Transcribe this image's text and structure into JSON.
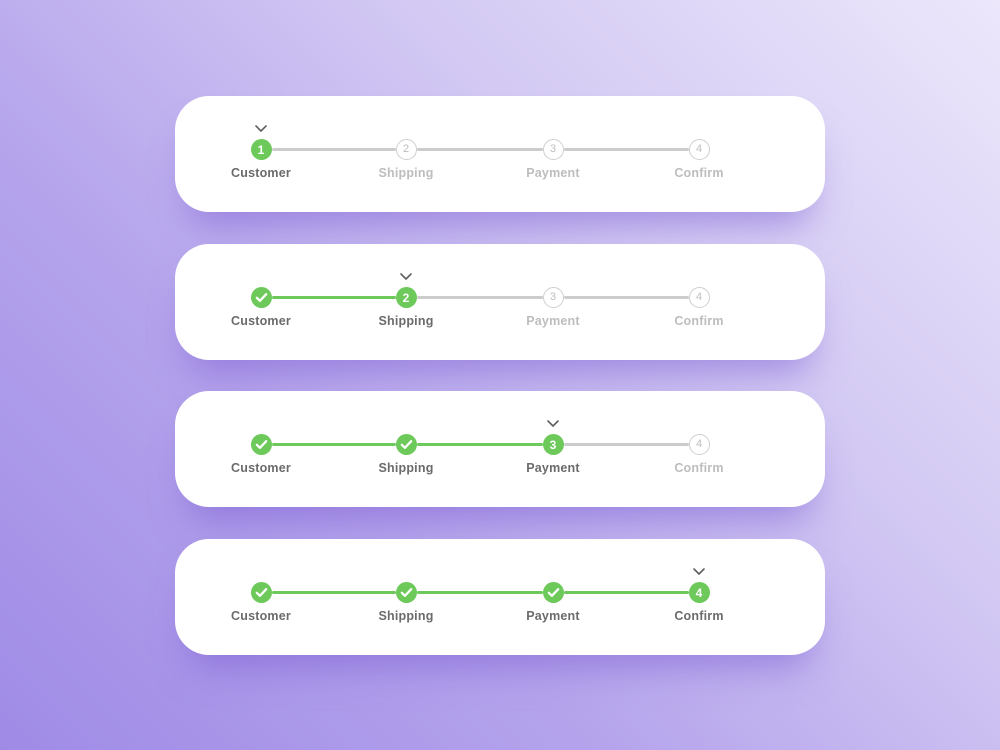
{
  "colors": {
    "accent": "#6cc95a",
    "track_inactive": "#cccccc",
    "caret": "#5f5f5f"
  },
  "steps": [
    {
      "number": "1",
      "label": "Customer"
    },
    {
      "number": "2",
      "label": "Shipping"
    },
    {
      "number": "3",
      "label": "Payment"
    },
    {
      "number": "4",
      "label": "Confirm"
    }
  ],
  "steppers": [
    {
      "current_step": 1
    },
    {
      "current_step": 2
    },
    {
      "current_step": 3
    },
    {
      "current_step": 4
    }
  ],
  "icons": {
    "completed": "check-icon",
    "current_marker": "chevron-down-icon"
  }
}
